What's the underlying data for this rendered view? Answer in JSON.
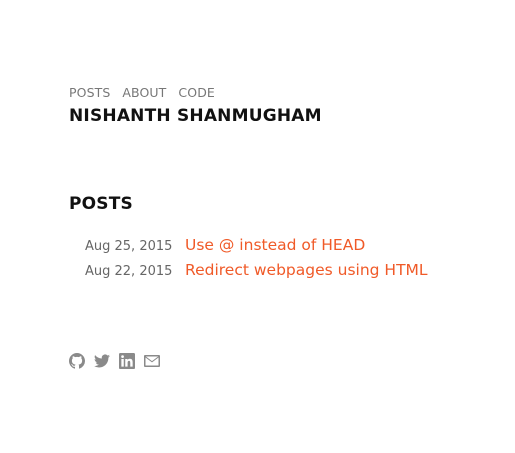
{
  "nav": {
    "items": [
      {
        "label": "POSTS"
      },
      {
        "label": "ABOUT"
      },
      {
        "label": "CODE"
      }
    ]
  },
  "site": {
    "title": "NISHANTH SHANMUGHAM"
  },
  "posts_section": {
    "heading": "POSTS",
    "items": [
      {
        "date": "Aug 25, 2015",
        "title": "Use @ instead of HEAD"
      },
      {
        "date": "Aug 22, 2015",
        "title": "Redirect webpages using HTML"
      }
    ]
  },
  "social": {
    "icons": [
      "github-icon",
      "twitter-icon",
      "linkedin-icon",
      "email-icon"
    ]
  },
  "colors": {
    "accent": "#f05a28",
    "nav": "#777777",
    "text": "#111111",
    "date": "#666666",
    "icon": "#8a8a8a"
  }
}
